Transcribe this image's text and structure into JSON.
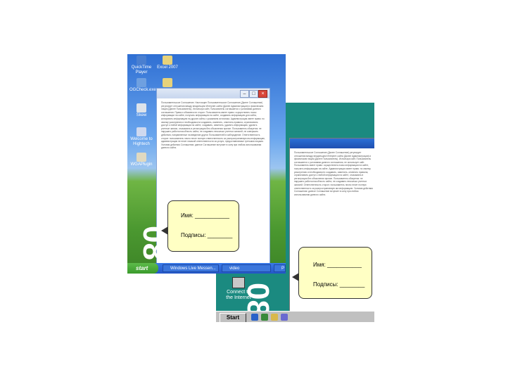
{
  "form": {
    "name_label": "Имя:",
    "name_line": "___________",
    "signature_label": "Подписы:",
    "signature_line": "________"
  },
  "xp": {
    "desktop_icons": [
      {
        "label": "QuickTime Player",
        "icon": "quicktime-icon"
      },
      {
        "label": "Excel 2007",
        "icon": "folder-icon"
      },
      {
        "label": "OGCheck.exe",
        "icon": "app-icon"
      },
      {
        "label": "Skew",
        "icon": "app-icon"
      },
      {
        "label": "Welcome to Hightech",
        "icon": "app-icon"
      },
      {
        "label": "WGAPlugin",
        "icon": "app-icon"
      }
    ],
    "window_text": "Пользовательское Соглашение. Настоящее Пользовательское Соглашение (Далее Соглашение) регулирует отношения между владельцем Интернет-сайта (Далее Администрация) и физическим лицом (Далее Пользователь). Используя сайт, Пользователь соглашается с условиями данного соглашения. Права и обязанности сторон. Пользователь имеет право: осуществлять поиск информации на сайте, получать информацию на сайте, создавать информацию для сайта, копировать информацию на другие сайты с указанием источника. Администрация имеет право: по своему усмотрению и необходимости создавать, изменять, отменять правила, ограничивать доступ к любой информации на сайте, создавать, изменять, удалять информацию, удалять учетные записи, отказывать в регистрации без объяснения причин. Пользователь обязуется: не нарушать работоспособность сайта, не создавать несколько учетных записей, не совершать действия, направленные на введение других Пользователей в заблуждение. Ответственность сторон: пользователь лично несет полную ответственность за распространяемую им информацию, администрация не несет никакой ответственности за услуги, предоставляемые третьими лицами. Условия действия Соглашения: данное Соглашение вступает в силу при любом использовании данного сайта.",
    "taskbar": {
      "start": "start",
      "tasks": [
        "Windows Live Messen...",
        "video",
        "P"
      ]
    },
    "big_text": "08"
  },
  "w98": {
    "desktop_icon": "Connect to the Internet",
    "window_text": "Пользовательское Соглашение (Далее Соглашение) регулирует отношения между владельцем Интернет-сайта (Далее Администрация) и физическим лицом (Далее Пользователь). Используя сайт, Пользователь соглашается с условиями данного соглашения, не использует сайт. Пользователь имеет право: осуществлять поиск информации на сайте, получать информацию на сайте. Администрация имеет право: по своему усмотрению и необходимости создавать, изменять, отменять правила, ограничивать доступ к любой информации на сайте, отказывать в регистрации без объяснения причин. Пользователь обязуется: не нарушать работоспособность сайта, не создавать несколько учетных записей. Ответственность сторон: пользователь лично несет полную ответственность за распространяемую им информацию. Условия действия Соглашения: данное Соглашение вступает в силу при любом использовании данного сайта.",
    "taskbar": {
      "start": "Start"
    },
    "big_text": "08"
  }
}
